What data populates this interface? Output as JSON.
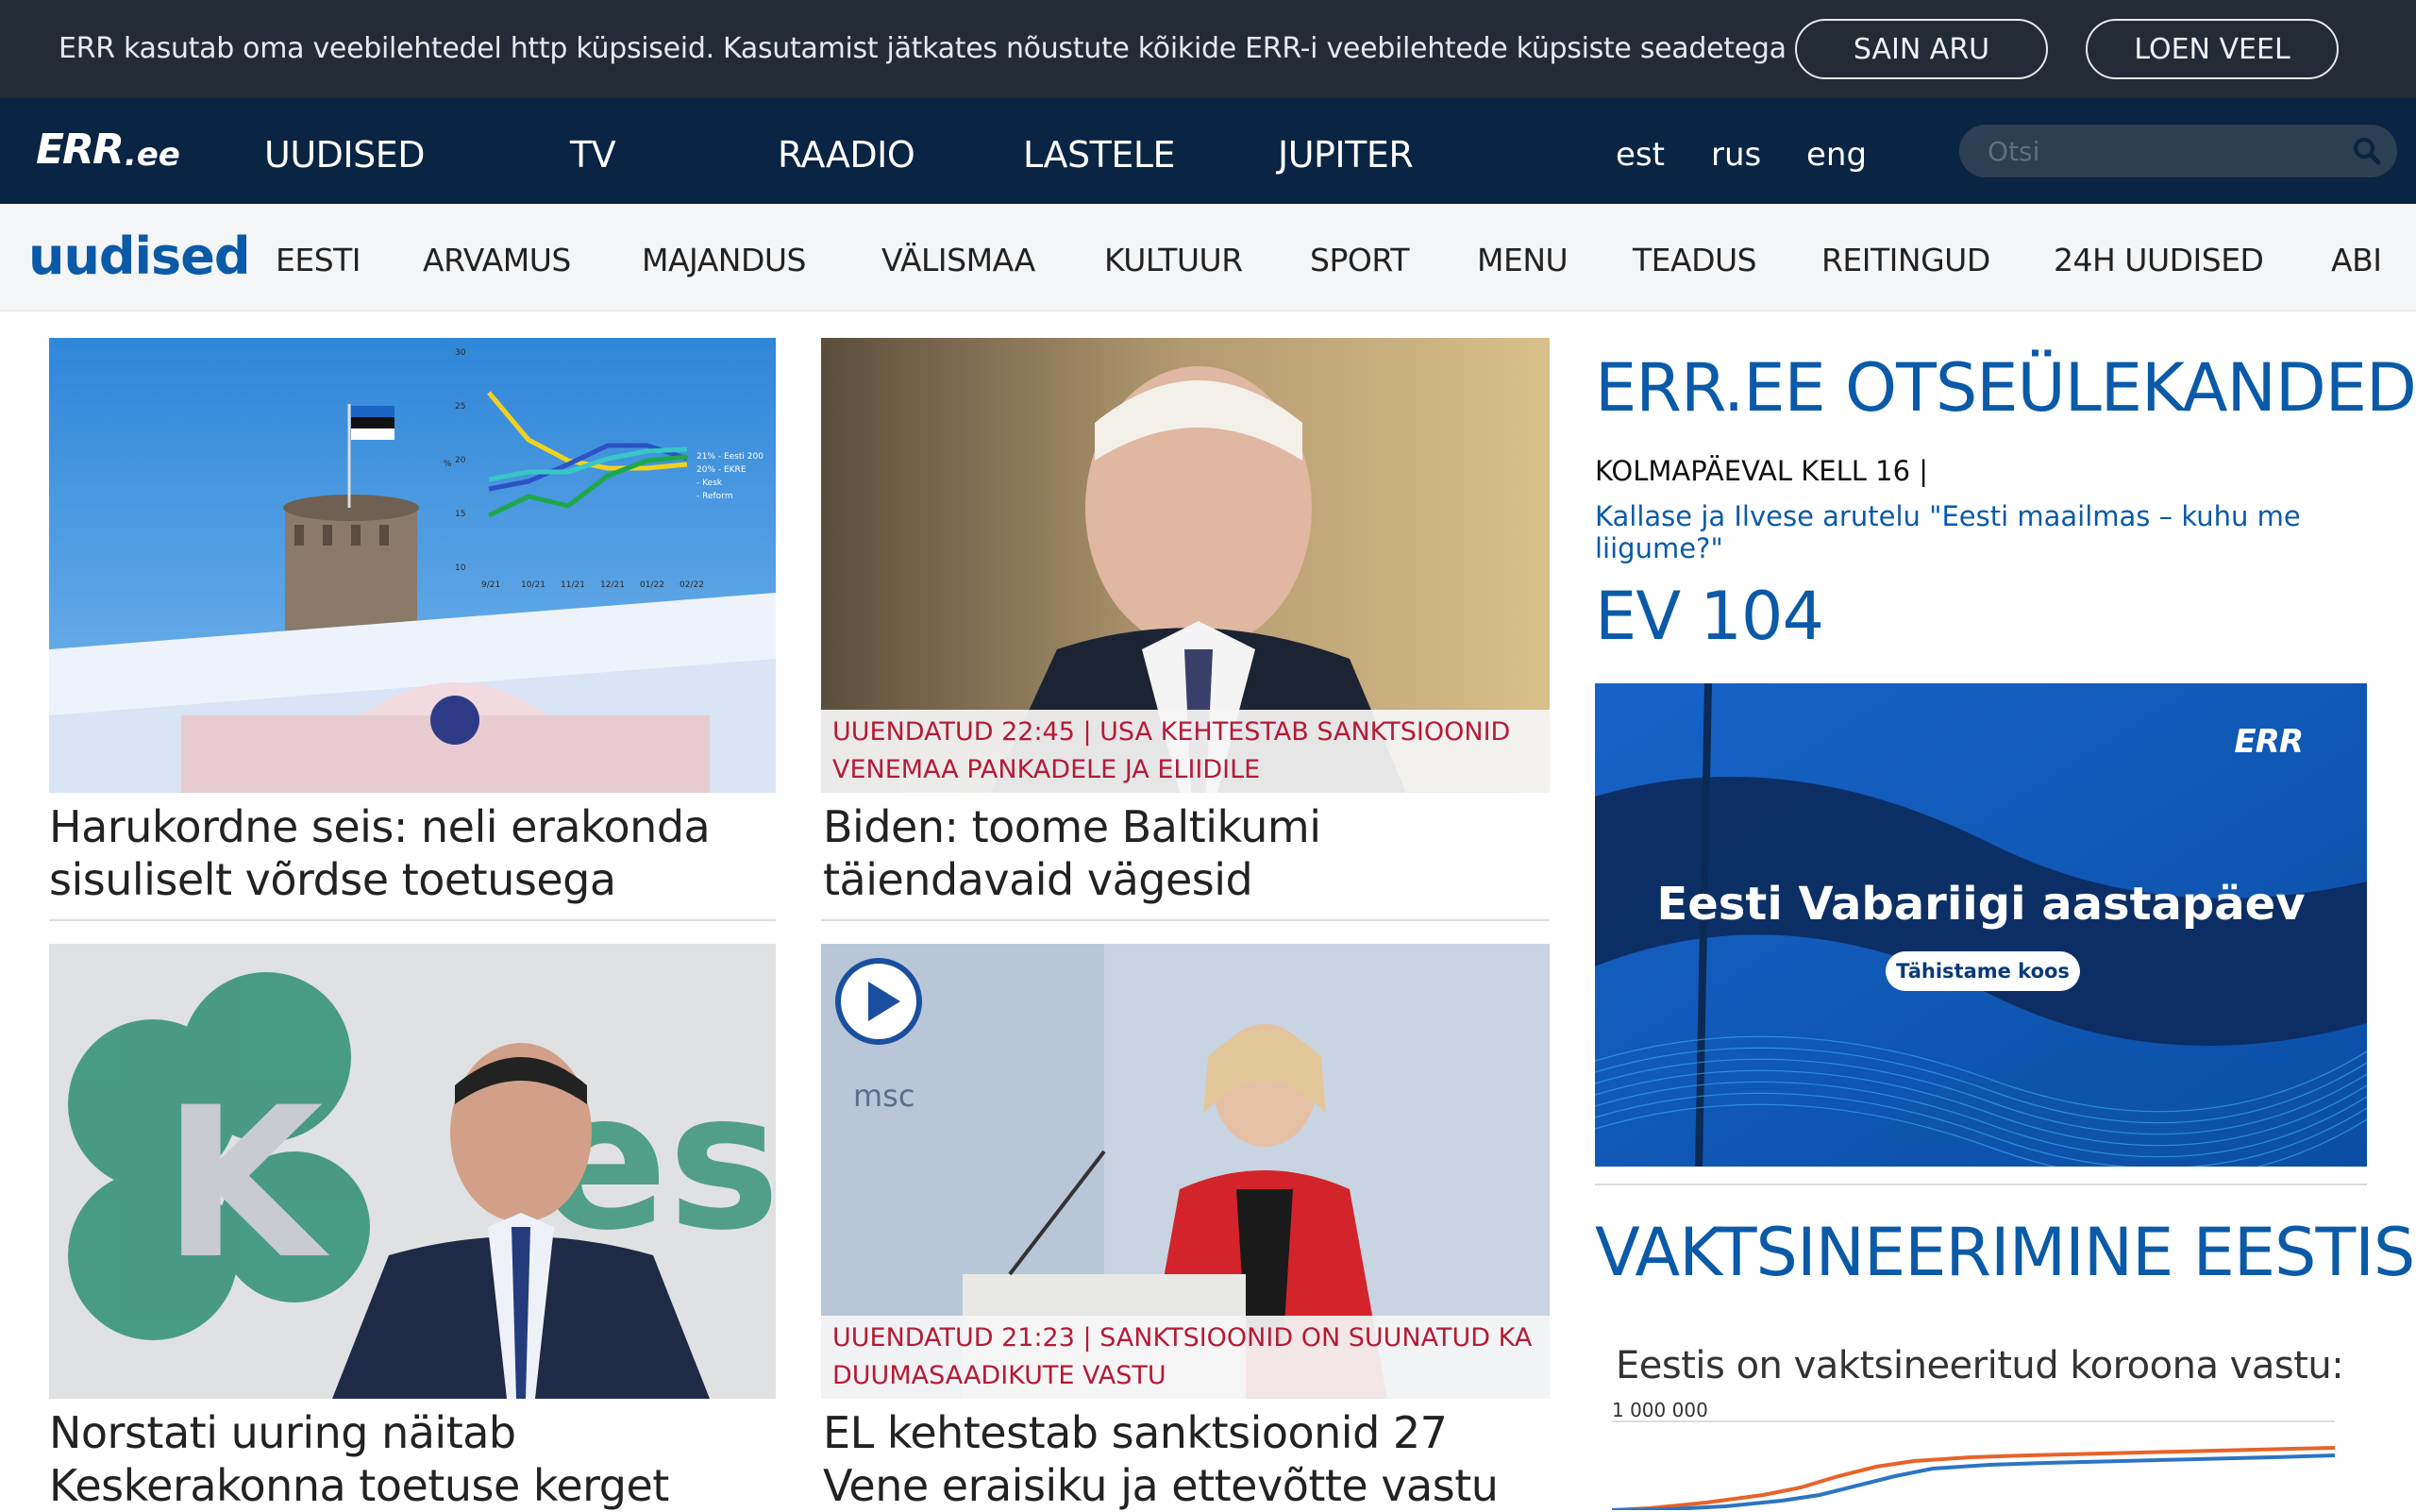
{
  "cookie": {
    "text": "ERR kasutab oma veebilehtedel http küpsiseid. Kasutamist jätkates nõustute kõikide ERR-i veebilehtede küpsiste seadetega",
    "accept_label": "SAIN ARU",
    "more_label": "LOEN VEEL"
  },
  "topnav": {
    "logo_main": "ERR",
    "logo_suffix": ".ee",
    "items": [
      "UUDISED",
      "TV",
      "RAADIO",
      "LASTELE",
      "JUPITER"
    ],
    "langs": [
      "est",
      "rus",
      "eng"
    ],
    "search_placeholder": "Otsi"
  },
  "subnav": {
    "section": "uudised",
    "items": [
      "EESTI",
      "ARVAMUS",
      "MAJANDUS",
      "VÄLISMAA",
      "KULTUUR",
      "SPORT",
      "MENU",
      "TEADUS",
      "REITINGUD",
      "24H UUDISED",
      "ABI"
    ]
  },
  "articles": [
    {
      "headline": "Harukordne seis: neli erakonda sisuliselt võrdse toetusega"
    },
    {
      "headline": "Biden: toome Baltikumi täiendavaid vägesid",
      "update": "Uuendatud 22:45 | USA kehtestab sanktsioonid Venemaa pankadele ja eliidile"
    },
    {
      "headline": "Norstati uuring näitab Keskerakonna toetuse kerget"
    },
    {
      "headline": "EL kehtestab sanktsioonid 27 Vene eraisiku ja ettevõtte vastu",
      "update": "Uuendatud 21:23 | sanktsioonid on suunatud ka duumasaadikute vastu"
    }
  ],
  "chart_thumb": {
    "y_ticks": [
      "30",
      "25",
      "20",
      "15",
      "10"
    ],
    "y_unit": "%",
    "x_ticks": [
      "9/21",
      "10/21",
      "11/21",
      "12/21",
      "01/22",
      "02/22"
    ],
    "legend": [
      "21% - Eesti 200",
      "20% - EKRE",
      "- Kesk",
      "- Reform"
    ]
  },
  "sidebar": {
    "live_heading": "ERR.EE OTSEÜLEKANDED",
    "live_when": "KOLMAPÄEVAL KELL 16 |",
    "live_link": "Kallase ja Ilvese arutelu \"Eesti maailmas – kuhu me liigume?\"",
    "ev_heading": "EV 104",
    "ev_banner_title": "Eesti Vabariigi aastapäev",
    "ev_banner_button": "Tähistame koos",
    "ev_banner_logo": "ERR",
    "vacc_heading": "VAKTSINEERIMINE EESTIS",
    "vacc_subtitle": "Eestis on vaktsineeritud koroona vastu:",
    "vacc_tick_top": "1 000 000"
  }
}
